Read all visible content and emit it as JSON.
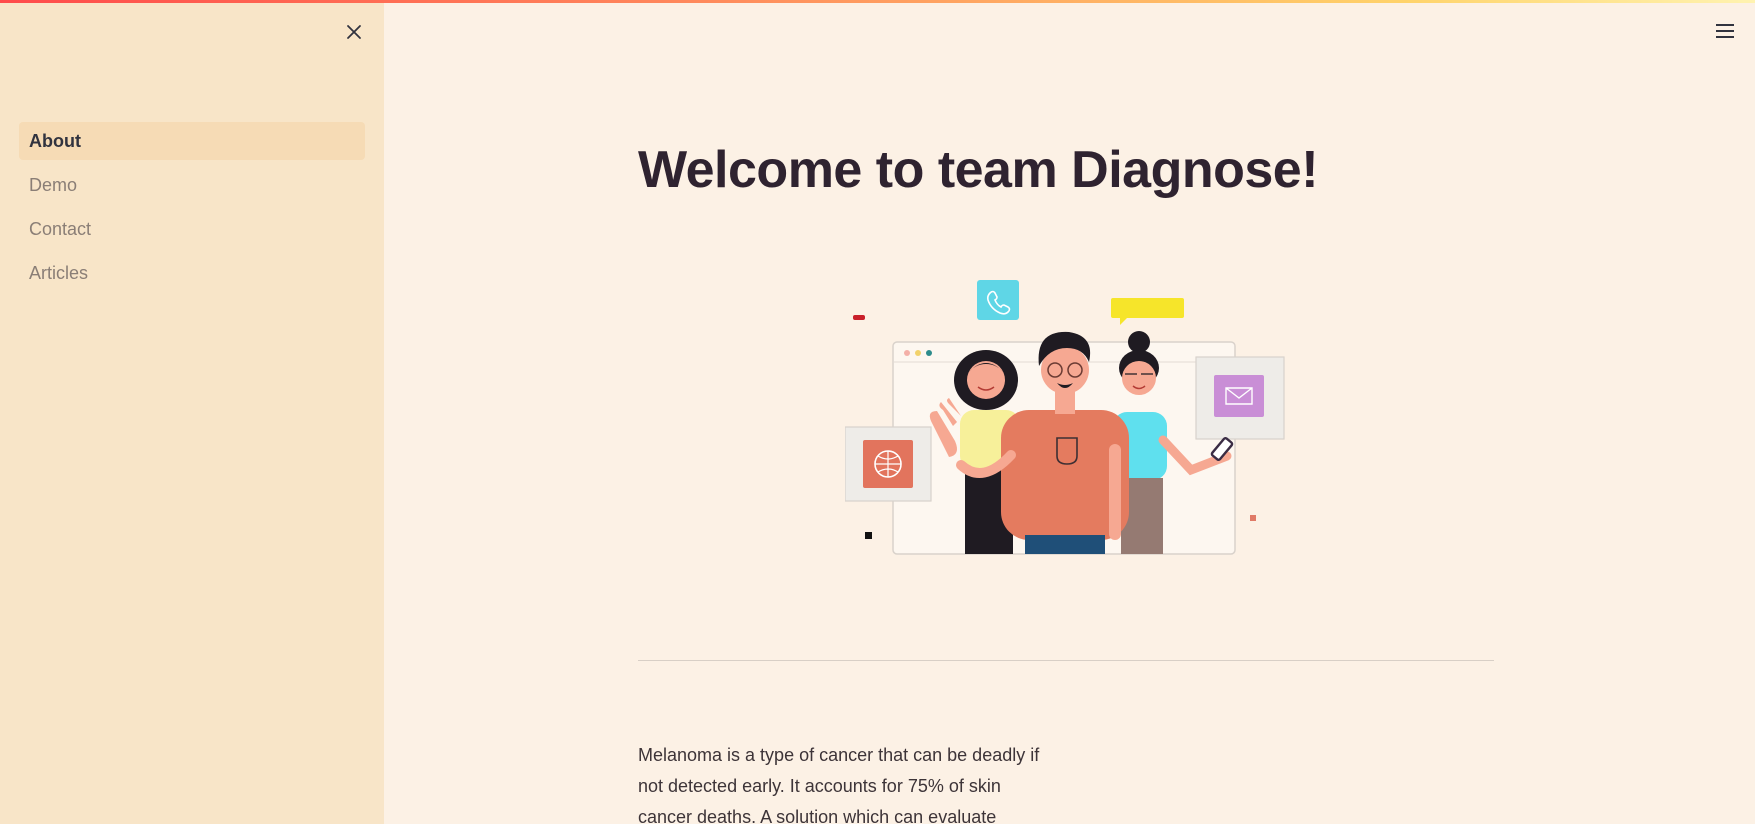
{
  "sidebar": {
    "items": [
      {
        "label": "About",
        "active": true
      },
      {
        "label": "Demo",
        "active": false
      },
      {
        "label": "Contact",
        "active": false
      },
      {
        "label": "Articles",
        "active": false
      }
    ],
    "close_icon": "close-icon"
  },
  "header": {
    "menu_icon": "hamburger-menu-icon"
  },
  "main": {
    "title": "Welcome to team Diagnose!",
    "illustration": "team-illustration",
    "paragraph": "Melanoma is a type of cancer that can be deadly if not detected early. It accounts for 75% of skin cancer deaths. A solution which can evaluate"
  },
  "colors": {
    "sidebar_bg": "#f8e5c8",
    "main_bg": "#fcf1e5",
    "active_item_bg": "#f6dbb5",
    "title": "#2f2330"
  }
}
